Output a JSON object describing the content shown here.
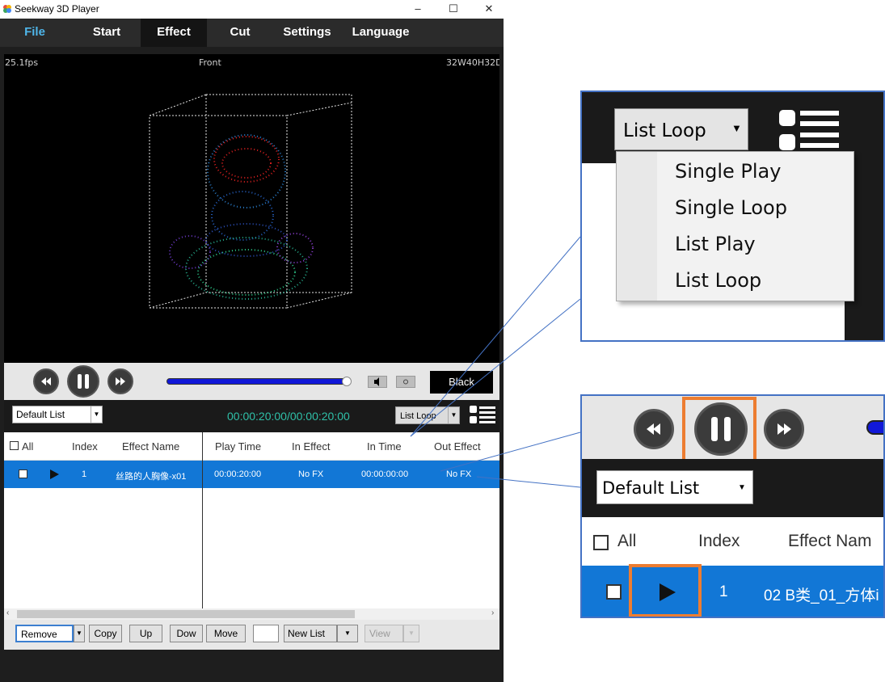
{
  "window": {
    "title": "Seekway 3D Player",
    "controls": [
      "–",
      "☐",
      "✕"
    ]
  },
  "menu": [
    "File",
    "Start",
    "Effect",
    "Cut",
    "Settings",
    "Language"
  ],
  "viewport": {
    "fps": "25.1fps",
    "view": "Front",
    "dims": "32W40H32D"
  },
  "controls": {
    "black_label": "Black",
    "progress": 1.0
  },
  "list": {
    "name": "Default List",
    "time": "00:00:20:00/00:00:20:00",
    "loop_mode": "List Loop"
  },
  "table": {
    "headers": [
      "All",
      "Index",
      "Effect Name",
      "Play Time",
      "In Effect",
      "In Time",
      "Out Effect"
    ],
    "rows": [
      {
        "index": "1",
        "name": "丝路的人胸像-x01",
        "play_time": "00:00:20:00",
        "in_effect": "No FX",
        "in_time": "00:00:00:00",
        "out_effect": "No FX"
      }
    ]
  },
  "bottom": {
    "remove": "Remove",
    "copy": "Copy",
    "up": "Up",
    "down": "Dow",
    "move": "Move",
    "new_list": "New List",
    "view": "View"
  },
  "callout_dropdown": {
    "selected": "List Loop",
    "options": [
      "Single Play",
      "Single Loop",
      "List Play",
      "List Loop"
    ]
  },
  "callout_controls": {
    "list_name": "Default List",
    "headers": [
      "All",
      "Index",
      "Effect Nam"
    ],
    "row_index": "1",
    "row_name": "02 B类_01_方体i"
  },
  "colors": {
    "accent_blue": "#1277d6",
    "callout_border": "#4472c4",
    "highlight_orange": "#ed7d31",
    "timer_teal": "#2fc0a8"
  }
}
